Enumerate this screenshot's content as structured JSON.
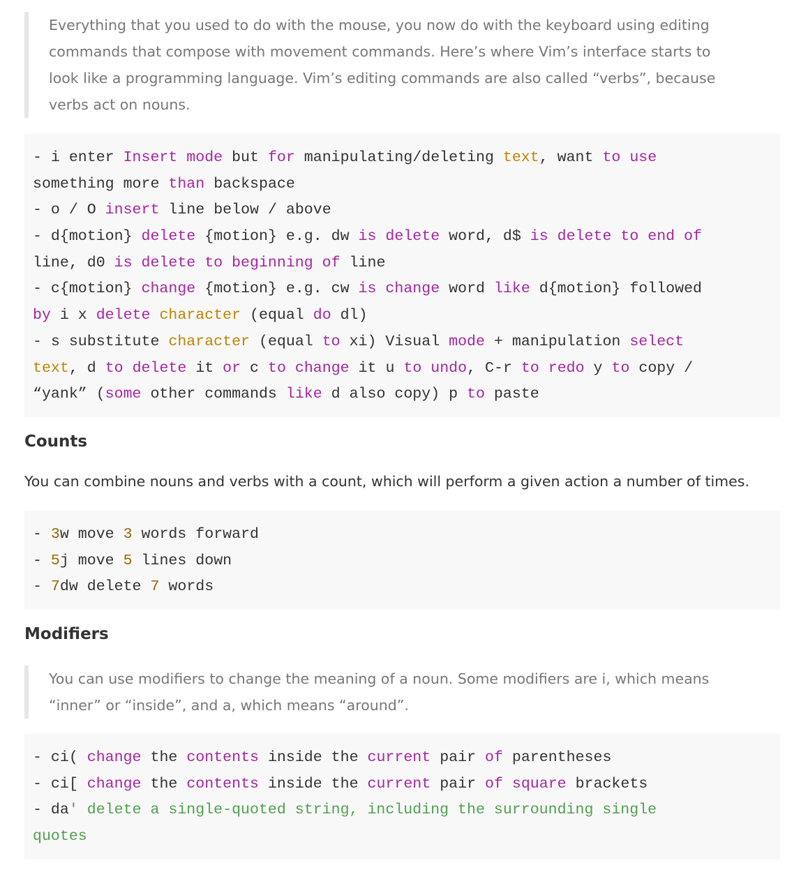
{
  "intro_quote": {
    "lines": [
      "Everything that you used to do with the mouse, you now do with the keyboard using editing",
      "commands that compose with movement commands. Here’s where Vim’s interface starts to",
      "look like a programming language. Vim’s editing commands are also called “verbs”, because",
      "verbs act on nouns."
    ]
  },
  "verbs_code": {
    "lines": [
      [
        [
          "p",
          "- i enter "
        ],
        [
          "k",
          "Insert mode"
        ],
        [
          "p",
          " but "
        ],
        [
          "k",
          "for"
        ],
        [
          "p",
          " manipulating/deleting "
        ],
        [
          "t",
          "text"
        ],
        [
          "p",
          ", want "
        ],
        [
          "k",
          "to use"
        ]
      ],
      [
        [
          "p",
          "something more "
        ],
        [
          "k",
          "than"
        ],
        [
          "p",
          " backspace"
        ]
      ],
      [
        [
          "p",
          "- o / O "
        ],
        [
          "k",
          "insert"
        ],
        [
          "p",
          " line below / above"
        ]
      ],
      [
        [
          "p",
          "- d{motion} "
        ],
        [
          "k",
          "delete"
        ],
        [
          "p",
          " {motion} e.g. dw "
        ],
        [
          "k",
          "is delete"
        ],
        [
          "p",
          " word, d$ "
        ],
        [
          "k",
          "is delete to end of"
        ]
      ],
      [
        [
          "p",
          "line, d0 "
        ],
        [
          "k",
          "is delete to beginning of"
        ],
        [
          "p",
          " line"
        ]
      ],
      [
        [
          "p",
          "- c{motion} "
        ],
        [
          "k",
          "change"
        ],
        [
          "p",
          " {motion} e.g. cw "
        ],
        [
          "k",
          "is change"
        ],
        [
          "p",
          " word "
        ],
        [
          "k",
          "like"
        ],
        [
          "p",
          " d{motion} followed"
        ]
      ],
      [
        [
          "k",
          "by"
        ],
        [
          "p",
          " i x "
        ],
        [
          "k",
          "delete"
        ],
        [
          "p",
          " "
        ],
        [
          "t",
          "character"
        ],
        [
          "p",
          " (equal "
        ],
        [
          "k",
          "do"
        ],
        [
          "p",
          " dl)"
        ]
      ],
      [
        [
          "p",
          "- s substitute "
        ],
        [
          "t",
          "character"
        ],
        [
          "p",
          " (equal "
        ],
        [
          "k",
          "to"
        ],
        [
          "p",
          " xi) Visual "
        ],
        [
          "k",
          "mode"
        ],
        [
          "p",
          " + manipulation "
        ],
        [
          "k",
          "select"
        ]
      ],
      [
        [
          "t",
          "text"
        ],
        [
          "p",
          ", d "
        ],
        [
          "k",
          "to delete"
        ],
        [
          "p",
          " it "
        ],
        [
          "k",
          "or"
        ],
        [
          "p",
          " c "
        ],
        [
          "k",
          "to change"
        ],
        [
          "p",
          " it u "
        ],
        [
          "k",
          "to undo"
        ],
        [
          "p",
          ", C-r "
        ],
        [
          "k",
          "to redo"
        ],
        [
          "p",
          " y "
        ],
        [
          "k",
          "to"
        ],
        [
          "p",
          " copy /"
        ]
      ],
      [
        [
          "p",
          "“yank” ("
        ],
        [
          "k",
          "some"
        ],
        [
          "p",
          " other commands "
        ],
        [
          "k",
          "like"
        ],
        [
          "p",
          " d also copy) p "
        ],
        [
          "k",
          "to"
        ],
        [
          "p",
          " paste"
        ]
      ]
    ]
  },
  "counts": {
    "heading": "Counts",
    "paragraph": "You can combine nouns and verbs with a count, which will perform a given action a number of times."
  },
  "counts_code": {
    "lines": [
      [
        [
          "p",
          "- "
        ],
        [
          "n",
          "3"
        ],
        [
          "p",
          "w move "
        ],
        [
          "n",
          "3"
        ],
        [
          "p",
          " words forward"
        ]
      ],
      [
        [
          "p",
          "- "
        ],
        [
          "n",
          "5"
        ],
        [
          "p",
          "j move "
        ],
        [
          "n",
          "5"
        ],
        [
          "p",
          " lines down"
        ]
      ],
      [
        [
          "p",
          "- "
        ],
        [
          "n",
          "7"
        ],
        [
          "p",
          "dw delete "
        ],
        [
          "n",
          "7"
        ],
        [
          "p",
          " words"
        ]
      ]
    ]
  },
  "modifiers": {
    "heading": "Modifiers",
    "quote_lines": [
      "You can use modifiers to change the meaning of a noun. Some modifiers are i, which means",
      "“inner” or “inside”, and a, which means “around”."
    ]
  },
  "modifiers_code": {
    "lines": [
      [
        [
          "p",
          "- ci( "
        ],
        [
          "k",
          "change"
        ],
        [
          "p",
          " the "
        ],
        [
          "k",
          "contents"
        ],
        [
          "p",
          " inside the "
        ],
        [
          "k",
          "current"
        ],
        [
          "p",
          " pair "
        ],
        [
          "k",
          "of"
        ],
        [
          "p",
          " parentheses"
        ]
      ],
      [
        [
          "p",
          "- ci[ "
        ],
        [
          "k",
          "change"
        ],
        [
          "p",
          " the "
        ],
        [
          "k",
          "contents"
        ],
        [
          "p",
          " inside the "
        ],
        [
          "k",
          "current"
        ],
        [
          "p",
          " pair "
        ],
        [
          "k",
          "of square"
        ],
        [
          "p",
          " brackets"
        ]
      ],
      [
        [
          "p",
          "- da"
        ],
        [
          "s",
          "' delete a single-quoted string, including the surrounding single"
        ]
      ],
      [
        [
          "s",
          "quotes"
        ]
      ]
    ]
  },
  "colors": {
    "keyword": "#a626a4",
    "type": "#c18401",
    "number": "#986801",
    "string": "#50a14f",
    "code_bg": "#f8f8f8",
    "quote_border": "#e6e6e6",
    "quote_text": "#777777"
  }
}
